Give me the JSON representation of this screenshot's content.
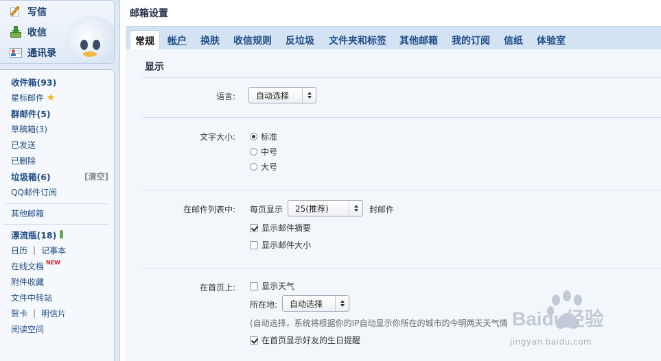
{
  "actions": {
    "compose": "写信",
    "inbox": "收信",
    "contacts": "通讯录"
  },
  "folders": {
    "inbox": "收件箱(93)",
    "starred": "星标邮件",
    "group": "群邮件(5)",
    "drafts": "草稿箱(3)",
    "sent": "已发送",
    "deleted": "已删除",
    "spam": "垃圾箱(6)",
    "spam_clear": "[清空]",
    "qq_subscription": "QQ邮件订阅",
    "other_mailbox": "其他邮箱",
    "drift_bottle": "漂流瓶(18)",
    "calendar": "日历",
    "notepad": "记事本",
    "online_docs": "在线文档",
    "new_badge": "NEW",
    "attachments": "附件收藏",
    "file_transfer": "文件中转站",
    "greeting_card": "贺卡",
    "postcard": "明信片",
    "reading_space": "阅读空间",
    "separator": "|"
  },
  "main": {
    "title": "邮箱设置",
    "tabs": [
      {
        "label": "常规"
      },
      {
        "label": "帐户"
      },
      {
        "label": "换肤"
      },
      {
        "label": "收信规则"
      },
      {
        "label": "反垃圾"
      },
      {
        "label": "文件夹和标签"
      },
      {
        "label": "其他邮箱"
      },
      {
        "label": "我的订阅"
      },
      {
        "label": "信纸"
      },
      {
        "label": "体验室"
      }
    ],
    "section_title": "显示",
    "language": {
      "label": "语言:",
      "value": "自动选择"
    },
    "font_size": {
      "label": "文字大小:",
      "options": [
        "标准",
        "中号",
        "大号"
      ],
      "selected": "标准"
    },
    "mail_list": {
      "label": "在邮件列表中:",
      "per_page_prefix": "每页显示",
      "per_page_value": "25(推荐)",
      "per_page_suffix": "封邮件",
      "show_summary": "显示邮件摘要",
      "show_summary_checked": true,
      "show_size": "显示邮件大小",
      "show_size_checked": false
    },
    "homepage": {
      "label": "在首页上:",
      "show_weather": "显示天气",
      "show_weather_checked": false,
      "location_label": "所在地:",
      "location_value": "自动选择",
      "hint": "(自动选择，系统将根据你的IP自动显示你所在的城市的今明两天天气情",
      "birthday_reminder": "在首页显示好友的生日提醒",
      "birthday_reminder_checked": true
    }
  },
  "watermark": {
    "brand": "Baidu经验",
    "url": "jingyan.baidu.com"
  },
  "colors": {
    "link": "#1f4c86",
    "tab_bar": "#d4e3f4",
    "panel_bg": "#f3f7fb",
    "star": "#f6b418",
    "new_badge": "#e02020"
  }
}
